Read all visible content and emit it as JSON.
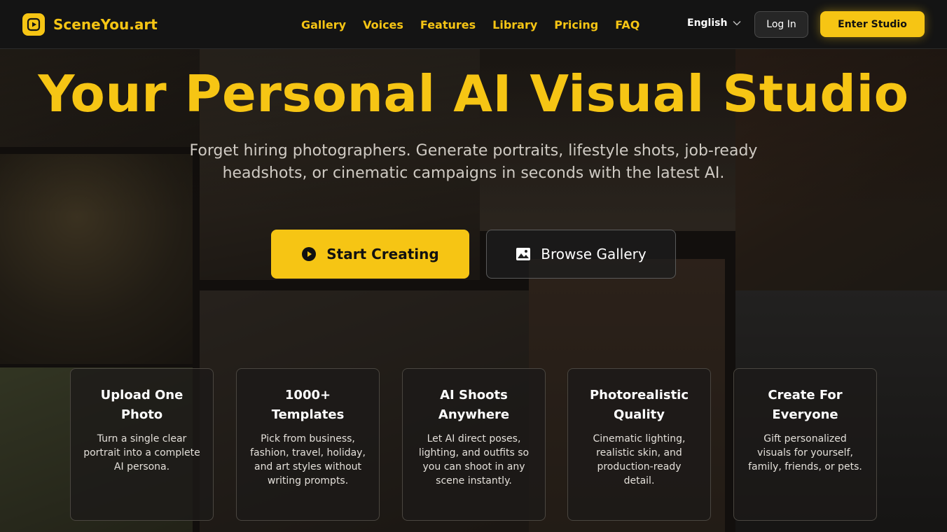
{
  "header": {
    "brand": "SceneYou.art",
    "nav": [
      "Gallery",
      "Voices",
      "Features",
      "Library",
      "Pricing",
      "FAQ"
    ],
    "language": "English",
    "login": "Log In",
    "enter_studio": "Enter Studio"
  },
  "hero": {
    "title": "Your Personal AI Visual Studio",
    "subtitle": "Forget hiring photographers. Generate portraits, lifestyle shots, job-ready headshots, or cinematic campaigns in seconds with the latest AI.",
    "cta_primary": "Start Creating",
    "cta_secondary": "Browse Gallery"
  },
  "features": [
    {
      "title": "Upload One Photo",
      "text": "Turn a single clear portrait into a complete AI persona."
    },
    {
      "title": "1000+ Templates",
      "text": "Pick from business, fashion, travel, holiday, and art styles without writing prompts."
    },
    {
      "title": "AI Shoots Anywhere",
      "text": "Let AI direct poses, lighting, and outfits so you can shoot in any scene instantly."
    },
    {
      "title": "Photorealistic Quality",
      "text": "Cinematic lighting, realistic skin, and production-ready detail."
    },
    {
      "title": "Create For Everyone",
      "text": "Gift personalized visuals for yourself, family, friends, or pets."
    }
  ],
  "colors": {
    "accent": "#f6c514",
    "header_bg": "#141414"
  },
  "icons": {
    "logo": "play-square-icon",
    "language": "chevron-down-icon",
    "start": "play-circle-icon",
    "gallery": "image-icon"
  }
}
